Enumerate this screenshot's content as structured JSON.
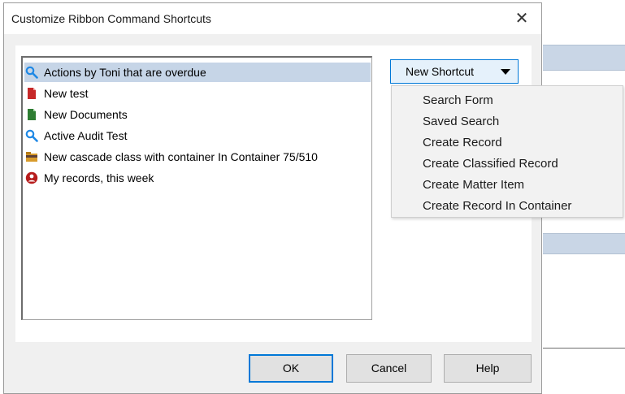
{
  "dialog": {
    "title": "Customize Ribbon Command Shortcuts",
    "close_glyph": "✕"
  },
  "shortcuts": [
    {
      "label": "Actions by Toni that are overdue",
      "icon": "search-icon",
      "selected": true
    },
    {
      "label": "New test",
      "icon": "red-document-icon",
      "selected": false
    },
    {
      "label": "New Documents",
      "icon": "green-document-icon",
      "selected": false
    },
    {
      "label": "Active Audit Test",
      "icon": "search-icon",
      "selected": false
    },
    {
      "label": "New cascade class with container In Container 75/510",
      "icon": "folder-icon",
      "selected": false
    },
    {
      "label": "My records, this week",
      "icon": "user-records-icon",
      "selected": false
    }
  ],
  "new_shortcut": {
    "label": "New Shortcut",
    "menu": [
      "Search Form",
      "Saved Search",
      "Create Record",
      "Create Classified Record",
      "Create Matter Item",
      "Create Record In Container"
    ]
  },
  "buttons": {
    "ok": "OK",
    "cancel": "Cancel",
    "help": "Help"
  },
  "colors": {
    "accent": "#0078d7",
    "selection": "#c6d5e7"
  }
}
